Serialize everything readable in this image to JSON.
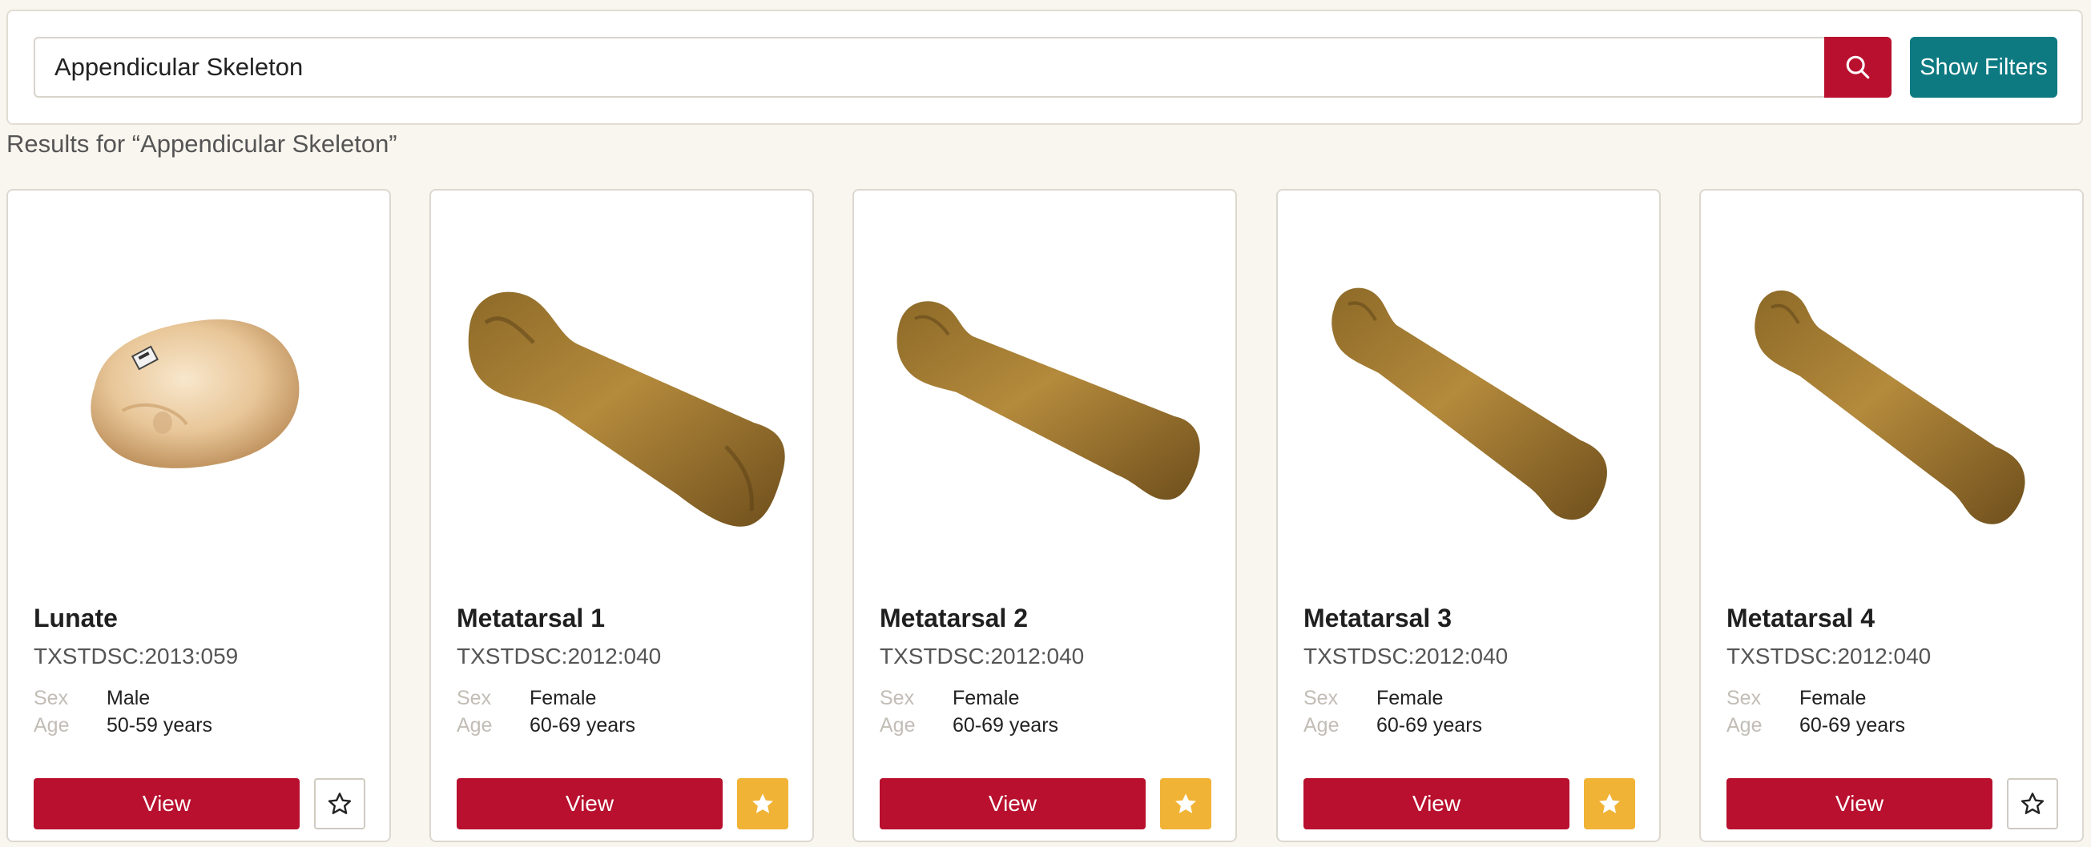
{
  "search": {
    "value": "Appendicular Skeleton",
    "search_icon": "search-icon",
    "filters_label": "Show Filters"
  },
  "results_heading": "Results for “Appendicular Skeleton”",
  "colors": {
    "primary": "#b8102e",
    "teal": "#0d7a82",
    "favorite": "#f0b336",
    "background": "#f9f6ef"
  },
  "cards": [
    {
      "title": "Lunate",
      "id": "TXSTDSC:2013:059",
      "sex_label": "Sex",
      "sex": "Male",
      "age_label": "Age",
      "age": "50-59 years",
      "view_label": "View",
      "favorited": false,
      "image": "lunate-bone-image"
    },
    {
      "title": "Metatarsal 1",
      "id": "TXSTDSC:2012:040",
      "sex_label": "Sex",
      "sex": "Female",
      "age_label": "Age",
      "age": "60-69 years",
      "view_label": "View",
      "favorited": true,
      "image": "metatarsal-bone-image"
    },
    {
      "title": "Metatarsal 2",
      "id": "TXSTDSC:2012:040",
      "sex_label": "Sex",
      "sex": "Female",
      "age_label": "Age",
      "age": "60-69 years",
      "view_label": "View",
      "favorited": true,
      "image": "metatarsal-bone-image"
    },
    {
      "title": "Metatarsal 3",
      "id": "TXSTDSC:2012:040",
      "sex_label": "Sex",
      "sex": "Female",
      "age_label": "Age",
      "age": "60-69 years",
      "view_label": "View",
      "favorited": true,
      "image": "metatarsal-bone-image"
    },
    {
      "title": "Metatarsal 4",
      "id": "TXSTDSC:2012:040",
      "sex_label": "Sex",
      "sex": "Female",
      "age_label": "Age",
      "age": "60-69 years",
      "view_label": "View",
      "favorited": false,
      "image": "metatarsal-bone-image"
    }
  ]
}
